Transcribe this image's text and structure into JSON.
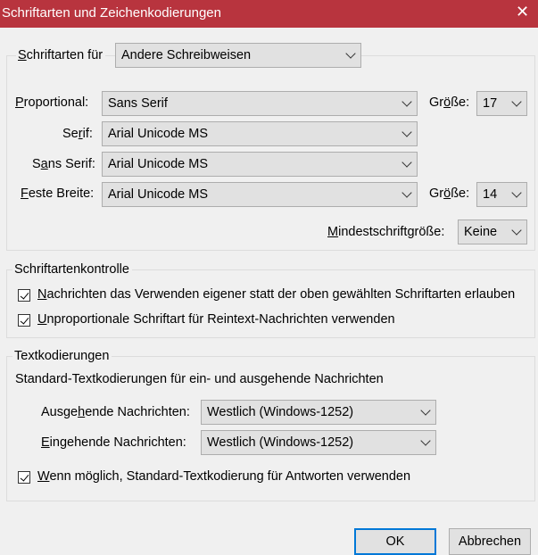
{
  "window": {
    "title": "Schriftarten und Zeichenkodierungen",
    "close_glyph": "✕"
  },
  "fonts": {
    "for_label_pre": "",
    "for_label_key": "S",
    "for_label_post": "chriftarten für",
    "for_value": "Andere Schreibweisen",
    "proportional": {
      "key": "P",
      "rest": "roportional:",
      "value": "Sans Serif"
    },
    "serif": {
      "pre": "Se",
      "key": "r",
      "rest": "if:",
      "value": "Arial Unicode MS"
    },
    "sans_serif": {
      "pre": "S",
      "key": "a",
      "rest": "ns Serif:",
      "value": "Arial Unicode MS"
    },
    "monospace": {
      "key": "F",
      "rest": "este Breite:",
      "value": "Arial Unicode MS"
    },
    "size_label_pre": "Gr",
    "size_label_key": "ö",
    "size_label_post": "ße:",
    "size2_label_pre": "Gr",
    "size2_label_key": "ö",
    "size2_label_post": "ße:",
    "proportional_size": "17",
    "monospace_size": "14",
    "min_size": {
      "key": "M",
      "rest": "indestschriftgröße:",
      "value": "Keine"
    }
  },
  "font_control": {
    "legend": "Schriftartenkontrolle",
    "allow_own": {
      "key": "N",
      "rest": "achrichten das Verwenden eigener statt der oben gewählten Schriftarten erlauben",
      "checked": true
    },
    "monospace_plain": {
      "key": "U",
      "rest": "nproportionale Schriftart für Reintext-Nachrichten verwenden",
      "checked": true
    }
  },
  "encodings": {
    "legend": "Textkodierungen",
    "description": "Standard-Textkodierungen für ein- und ausgehende Nachrichten",
    "outgoing": {
      "pre": "Ausge",
      "key": "h",
      "rest": "ende Nachrichten:",
      "value": "Westlich (Windows-1252)"
    },
    "incoming": {
      "pre": "",
      "key": "E",
      "rest": "ingehende Nachrichten:",
      "value": "Westlich (Windows-1252)"
    },
    "reply_default": {
      "key": "W",
      "rest": "enn möglich, Standard-Textkodierung für Antworten verwenden",
      "checked": true
    }
  },
  "buttons": {
    "ok": "OK",
    "cancel": "Abbrechen"
  }
}
